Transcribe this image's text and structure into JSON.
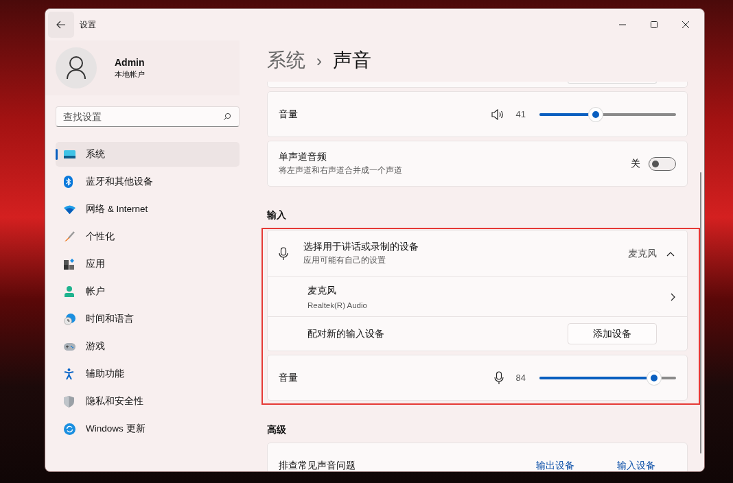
{
  "window": {
    "title": "设置"
  },
  "account": {
    "name": "Admin",
    "type": "本地帐户"
  },
  "search": {
    "placeholder": "查找设置"
  },
  "nav": [
    {
      "label": "系统",
      "selected": true
    },
    {
      "label": "蓝牙和其他设备",
      "selected": false
    },
    {
      "label": "网络 & Internet",
      "selected": false
    },
    {
      "label": "个性化",
      "selected": false
    },
    {
      "label": "应用",
      "selected": false
    },
    {
      "label": "帐户",
      "selected": false
    },
    {
      "label": "时间和语言",
      "selected": false
    },
    {
      "label": "游戏",
      "selected": false
    },
    {
      "label": "辅助功能",
      "selected": false
    },
    {
      "label": "隐私和安全性",
      "selected": false
    },
    {
      "label": "Windows 更新",
      "selected": false
    }
  ],
  "breadcrumb": {
    "parent": "系统",
    "separator": "›",
    "current": "声音"
  },
  "output": {
    "volume": {
      "label": "音量",
      "reading": "41",
      "level": 0.41
    },
    "mono": {
      "title": "单声道音频",
      "description": "将左声道和右声道合并成一个声道",
      "state_label": "关",
      "on": false
    }
  },
  "input": {
    "heading": "输入",
    "picker": {
      "title": "选择用于讲话或录制的设备",
      "subtitle": "应用可能有自己的设置",
      "value": "麦克风",
      "expanded": true
    },
    "devices": [
      {
        "name": "麦克风",
        "detail": "Realtek(R) Audio"
      }
    ],
    "pair": {
      "label": "配对新的输入设备",
      "button": "添加设备"
    },
    "volume": {
      "label": "音量",
      "reading": "84",
      "level": 0.84
    }
  },
  "advanced": {
    "heading": "高级",
    "troubleshoot": {
      "label": "排查常见声音问题",
      "links": [
        "输出设备",
        "输入设备"
      ]
    }
  }
}
